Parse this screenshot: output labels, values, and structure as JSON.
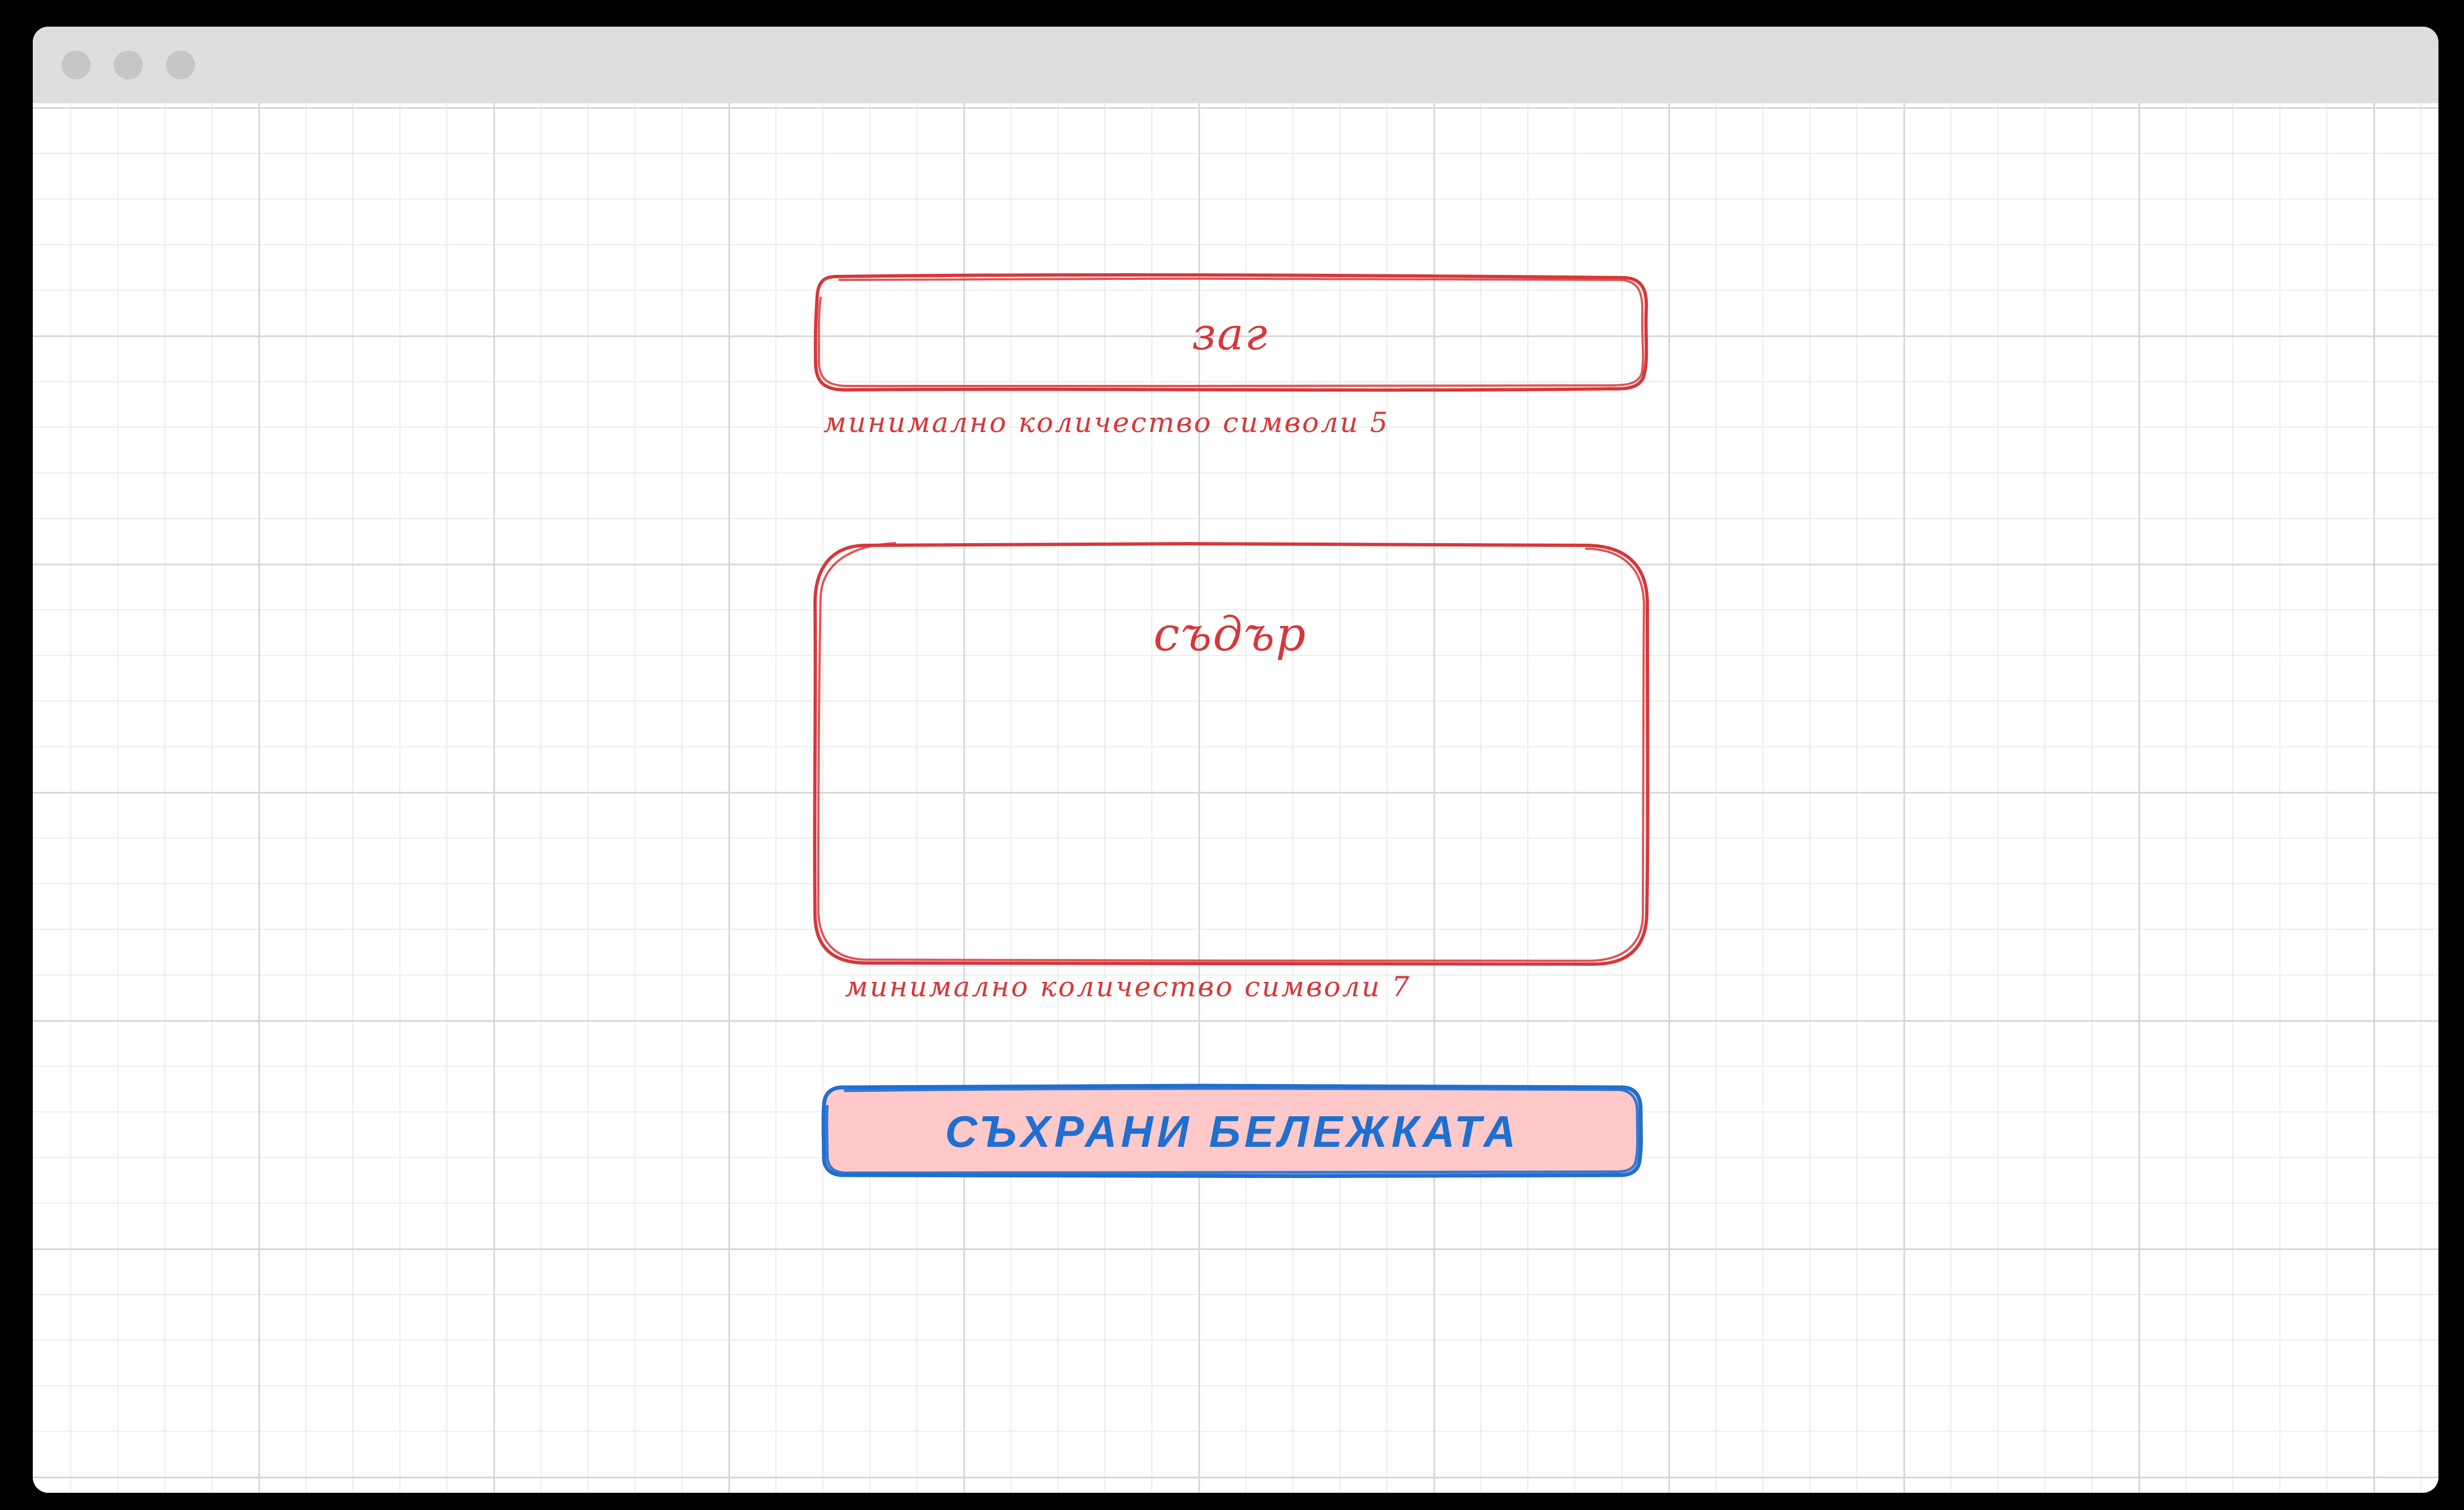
{
  "window": {
    "controls": [
      {
        "name": "close-control"
      },
      {
        "name": "minimize-control"
      },
      {
        "name": "zoom-control"
      }
    ]
  },
  "form": {
    "title_field": {
      "value": "заг",
      "hint": "минимално количество символи 5"
    },
    "content_field": {
      "value": "съдър",
      "hint": "минимално количество символи 7"
    },
    "save_button": {
      "label": "СЪХРАНИ БЕЛЕЖКАТА"
    }
  },
  "colors": {
    "field_stroke": "#d7373a",
    "field_text": "#d7373a",
    "button_stroke": "#1f6fd0",
    "button_fill": "#ffc9c9",
    "button_text": "#1f6fd0",
    "grid_major": "#d8d8d8",
    "grid_minor": "#ececec",
    "titlebar": "#dedede"
  }
}
